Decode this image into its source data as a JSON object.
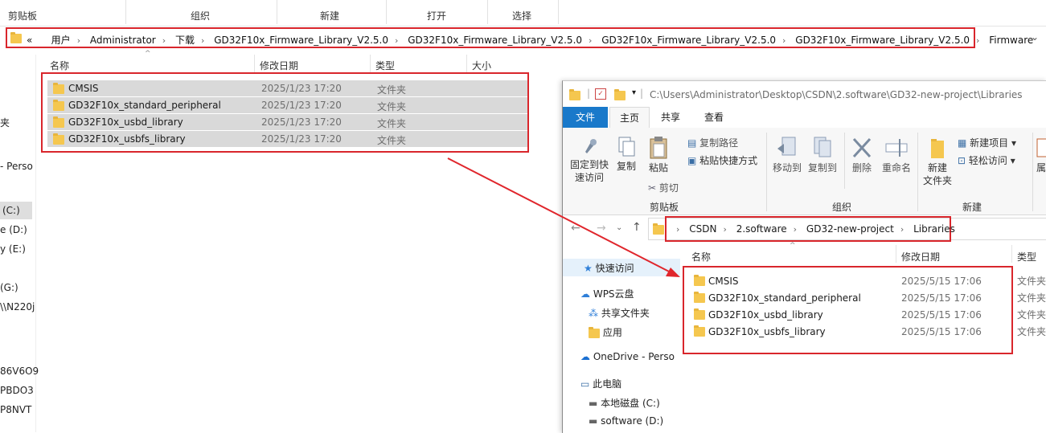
{
  "back_window": {
    "ribbon_groups": [
      "剪贴板",
      "组织",
      "新建",
      "打开",
      "选择"
    ],
    "breadcrumb": [
      "用户",
      "Administrator",
      "下载",
      "GD32F10x_Firmware_Library_V2.5.0",
      "GD32F10x_Firmware_Library_V2.5.0",
      "GD32F10x_Firmware_Library_V2.5.0",
      "GD32F10x_Firmware_Library_V2.5.0",
      "Firmware"
    ],
    "breadcrumb_prefix": "«",
    "columns": [
      "名称",
      "修改日期",
      "类型",
      "大小"
    ],
    "rows": [
      {
        "name": "CMSIS",
        "date": "2025/1/23 17:20",
        "type": "文件夹"
      },
      {
        "name": "GD32F10x_standard_peripheral",
        "date": "2025/1/23 17:20",
        "type": "文件夹"
      },
      {
        "name": "GD32F10x_usbd_library",
        "date": "2025/1/23 17:20",
        "type": "文件夹"
      },
      {
        "name": "GD32F10x_usbfs_library",
        "date": "2025/1/23 17:20",
        "type": "文件夹"
      }
    ],
    "sidebar_fragments": [
      "夹",
      "- Perso",
      "(C:)",
      "e (D:)",
      "y (E:)",
      "(G:)",
      "\\\\N220j",
      "86V6O9",
      "PBDO3",
      "P8NVT"
    ]
  },
  "front_window": {
    "title_path": "C:\\Users\\Administrator\\Desktop\\CSDN\\2.software\\GD32-new-project\\Libraries",
    "tabs": [
      "文件",
      "主页",
      "共享",
      "查看"
    ],
    "ribbon": {
      "pin_label": "固定到快\n速访问",
      "copy_label": "复制",
      "paste_label": "粘贴",
      "copy_path": "复制路径",
      "paste_shortcut": "粘贴快捷方式",
      "cut": "剪切",
      "move_to": "移动到",
      "copy_to": "复制到",
      "delete": "删除",
      "rename": "重命名",
      "new_folder": "新建\n文件夹",
      "new_item": "新建项目",
      "easy_access": "轻松访问",
      "props_partial": "属",
      "group_clipboard": "剪贴板",
      "group_organize": "组织",
      "group_new": "新建"
    },
    "breadcrumb": [
      "CSDN",
      "2.software",
      "GD32-new-project",
      "Libraries"
    ],
    "columns": [
      "名称",
      "修改日期",
      "类型"
    ],
    "rows": [
      {
        "name": "CMSIS",
        "date": "2025/5/15 17:06",
        "type": "文件夹"
      },
      {
        "name": "GD32F10x_standard_peripheral",
        "date": "2025/5/15 17:06",
        "type": "文件夹"
      },
      {
        "name": "GD32F10x_usbd_library",
        "date": "2025/5/15 17:06",
        "type": "文件夹"
      },
      {
        "name": "GD32F10x_usbfs_library",
        "date": "2025/5/15 17:06",
        "type": "文件夹"
      }
    ],
    "nav": {
      "quick_access": "快速访问",
      "wps": "WPS云盘",
      "shared": "共享文件夹",
      "apps": "应用",
      "onedrive": "OneDrive - Perso",
      "this_pc": "此电脑",
      "local_disk": "本地磁盘 (C:)",
      "software": "software (D:)"
    }
  },
  "colors": {
    "highlight": "#d9262c",
    "accent_tab": "#1979ca",
    "selected_row": "#d9d9d9"
  }
}
